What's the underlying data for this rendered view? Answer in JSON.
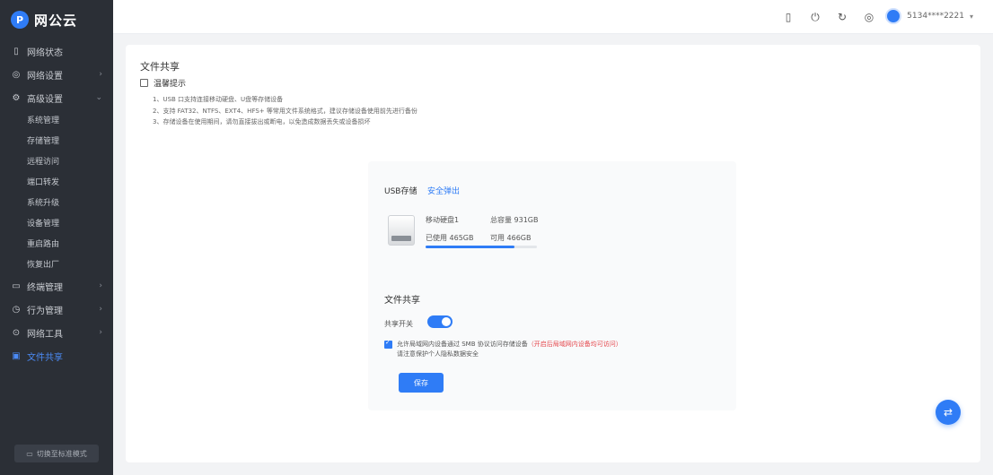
{
  "app": {
    "logo_mark": "P",
    "logo_text": "网公云"
  },
  "sidebar": {
    "items": [
      {
        "icon": "▯",
        "label": "网络状态",
        "has_chevron": false
      },
      {
        "icon": "◎",
        "label": "网络设置",
        "has_chevron": true
      },
      {
        "icon": "⚙",
        "label": "高级设置",
        "has_chevron": true,
        "expanded": true
      }
    ],
    "subitems": [
      "系统管理",
      "存储管理",
      "远程访问",
      "端口转发",
      "系统升级",
      "设备管理",
      "重启路由",
      "恢复出厂"
    ],
    "items_after": [
      {
        "icon": "▭",
        "label": "终端管理",
        "has_chevron": true
      },
      {
        "icon": "◷",
        "label": "行为管理",
        "has_chevron": true
      },
      {
        "icon": "⊙",
        "label": "网络工具",
        "has_chevron": true
      },
      {
        "icon": "▣",
        "label": "文件共享",
        "has_chevron": false,
        "active": true
      }
    ],
    "footer": "切换至标准模式"
  },
  "header": {
    "icons": [
      "▯",
      "⏻",
      "↻",
      "◎"
    ],
    "user_name": "5134****2221",
    "user_chevron": "▾"
  },
  "main": {
    "title": "文件共享",
    "tips_title": "温馨提示",
    "tips": [
      "1、USB 口支持连接移动硬盘、U盘等存储设备",
      "2、支持 FAT32、NTFS、EXT4、HFS+ 等常用文件系统格式，建议存储设备使用前先进行备份",
      "3、存储设备在使用期间，请勿直接拔出或断电，以免造成数据丢失或设备损坏"
    ]
  },
  "storage": {
    "label": "USB存储",
    "link": "安全弹出",
    "disk_name": "移动硬盘1",
    "disk_size": "总容量 931GB",
    "used": "已使用 465GB",
    "free": "可用 466GB",
    "used_percent": 80
  },
  "share": {
    "title": "文件共享",
    "toggle_label": "共享开关",
    "toggle_on": true,
    "checkbox_checked": true,
    "checkbox_text": "允许局域网内设备通过 SMB 协议访问存储设备",
    "checkbox_warning": "（开启后局域网内设备均可访问）",
    "checkbox_text2": "请注意保护个人隐私数据安全",
    "save_label": "保存"
  },
  "fab": {
    "icon": "⇄"
  }
}
